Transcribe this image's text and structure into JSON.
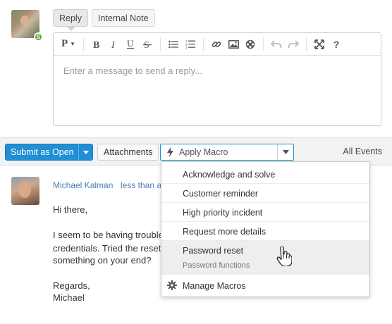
{
  "composer": {
    "tabs": [
      "Reply",
      "Internal Note"
    ],
    "status_badge": "S",
    "placeholder": "Enter a message to send a reply...",
    "toolbar": {
      "paragraph_label": "P",
      "icons": [
        "paragraph-icon",
        "bold-icon",
        "italic-icon",
        "underline-icon",
        "strikethrough-icon",
        "bullet-list-icon",
        "numbered-list-icon",
        "link-icon",
        "image-icon",
        "media-icon",
        "undo-icon",
        "redo-icon",
        "fullscreen-icon",
        "help-icon"
      ]
    }
  },
  "actions": {
    "submit_label": "Submit as Open",
    "attachments_label": "Attachments",
    "macro_placeholder": "Apply Macro",
    "all_events_label": "All Events"
  },
  "macro_menu": {
    "items": [
      {
        "label": "Acknowledge and solve"
      },
      {
        "label": "Customer reminder"
      },
      {
        "label": "High priority incident"
      },
      {
        "label": "Request more details"
      },
      {
        "label": "Password reset",
        "sub": "Password functions",
        "highlighted": true
      }
    ],
    "manage_label": "Manage Macros"
  },
  "message": {
    "author": "Michael Kalman",
    "time": "less than a",
    "greeting": "Hi there,",
    "body_lines": [
      "I seem to be having trouble",
      "credentials. Tried the reset",
      "something on your end?"
    ],
    "signoff": "Regards,",
    "signature": "Michael"
  },
  "colors": {
    "primary": "#1f8fd6",
    "link": "#4a7fb0",
    "status_green": "#5ca832"
  }
}
